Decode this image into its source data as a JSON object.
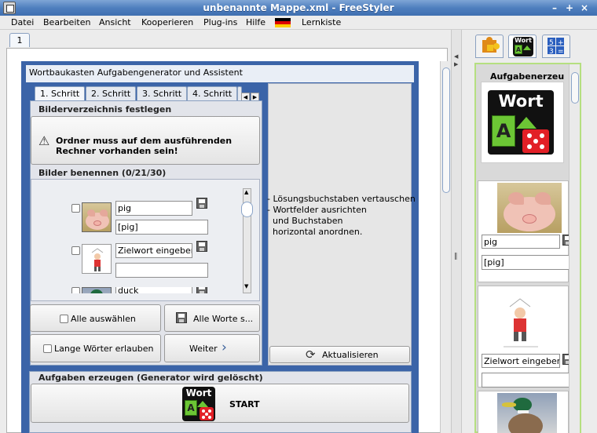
{
  "window": {
    "title": "unbenannte Mappe.xml - FreeStyler"
  },
  "menu": [
    "Datei",
    "Bearbeiten",
    "Ansicht",
    "Kooperieren",
    "Plug-ins",
    "Hilfe",
    "Lernkiste"
  ],
  "doc_tab": "1",
  "panel": {
    "title": "Wortbaukasten Aufgabengenerator und Assistent",
    "steps": [
      "1. Schritt",
      "2. Schritt",
      "3. Schritt",
      "4. Schritt"
    ],
    "dir_group": {
      "title": "Bilderverzeichnis festlegen",
      "message_line1": "Ordner muss auf dem ausführenden",
      "message_line2": "Rechner vorhanden sein!"
    },
    "names_group": {
      "title": "Bilder benennen (0/21/30)",
      "items": [
        {
          "word": "pig",
          "tagged": "[pig]"
        },
        {
          "word": "Zielwort eingeben",
          "tagged": ""
        },
        {
          "word": "duck",
          "tagged": ""
        }
      ]
    },
    "buttons": {
      "select_all": "Alle auswählen",
      "save_all": "Alle Worte s...",
      "long_words": "Lange Wörter erlauben",
      "next": "Weiter",
      "refresh": "Aktualisieren"
    },
    "notes": [
      "- Lösungsbuchstaben vertauschen",
      "- Wortfelder ausrichten",
      "  und Buchstaben",
      "  horizontal anordnen."
    ],
    "generate_group": {
      "title": "Aufgaben erzeugen (Generator wird gelöscht)",
      "start": "START"
    }
  },
  "logo": {
    "word": "Wort",
    "letter": "A"
  },
  "sidebar": {
    "heading": "Aufgabenerzeu",
    "items": [
      {
        "word": "pig",
        "tagged": "[pig]"
      },
      {
        "word": "Zielwort eingeben",
        "tagged": ""
      }
    ]
  },
  "colors": {
    "panel_blue": "#3b64a8",
    "sidebar_border": "#b5df80",
    "die_red": "#e21f26",
    "logo_green": "#6cc635"
  }
}
